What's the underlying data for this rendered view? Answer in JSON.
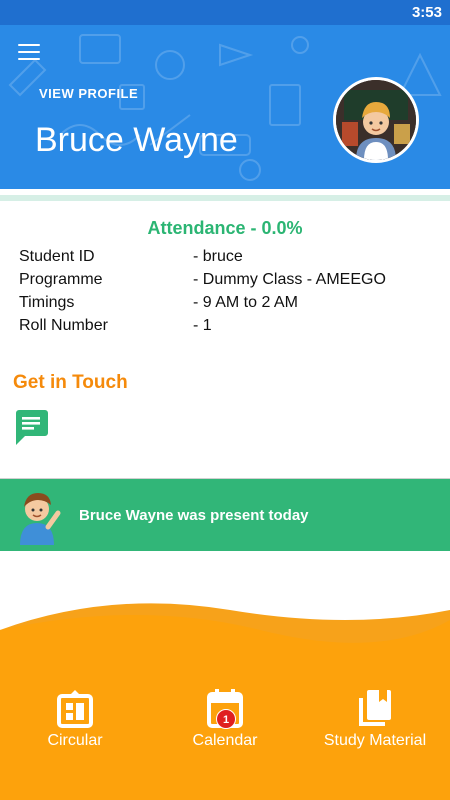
{
  "status_bar": {
    "time": "3:53"
  },
  "header": {
    "view_profile": "VIEW PROFILE",
    "name": "Bruce Wayne"
  },
  "attendance": {
    "text": "Attendance - 0.0%"
  },
  "student_info": [
    {
      "label": "Student ID",
      "value": "- bruce"
    },
    {
      "label": "Programme",
      "value": "- Dummy Class - AMEEGO"
    },
    {
      "label": "Timings",
      "value": "- 9 AM to 2 AM"
    },
    {
      "label": "Roll Number",
      "value": "- 1"
    }
  ],
  "contact": {
    "title": "Get in Touch",
    "icon": "chat-icon"
  },
  "banner": {
    "text": "Bruce Wayne was present today"
  },
  "bottom_nav": [
    {
      "label": "Circular",
      "icon": "circular-icon"
    },
    {
      "label": "Calendar",
      "icon": "calendar-icon",
      "badge": "1"
    },
    {
      "label": "Study Material",
      "icon": "book-icon"
    }
  ],
  "colors": {
    "header_blue": "#2a8ae6",
    "status_blue": "#1f6fcf",
    "attendance_green": "#2bb573",
    "accent_orange": "#f58a0b",
    "banner_green": "#31b678",
    "bottom_orange": "#fda20c"
  }
}
